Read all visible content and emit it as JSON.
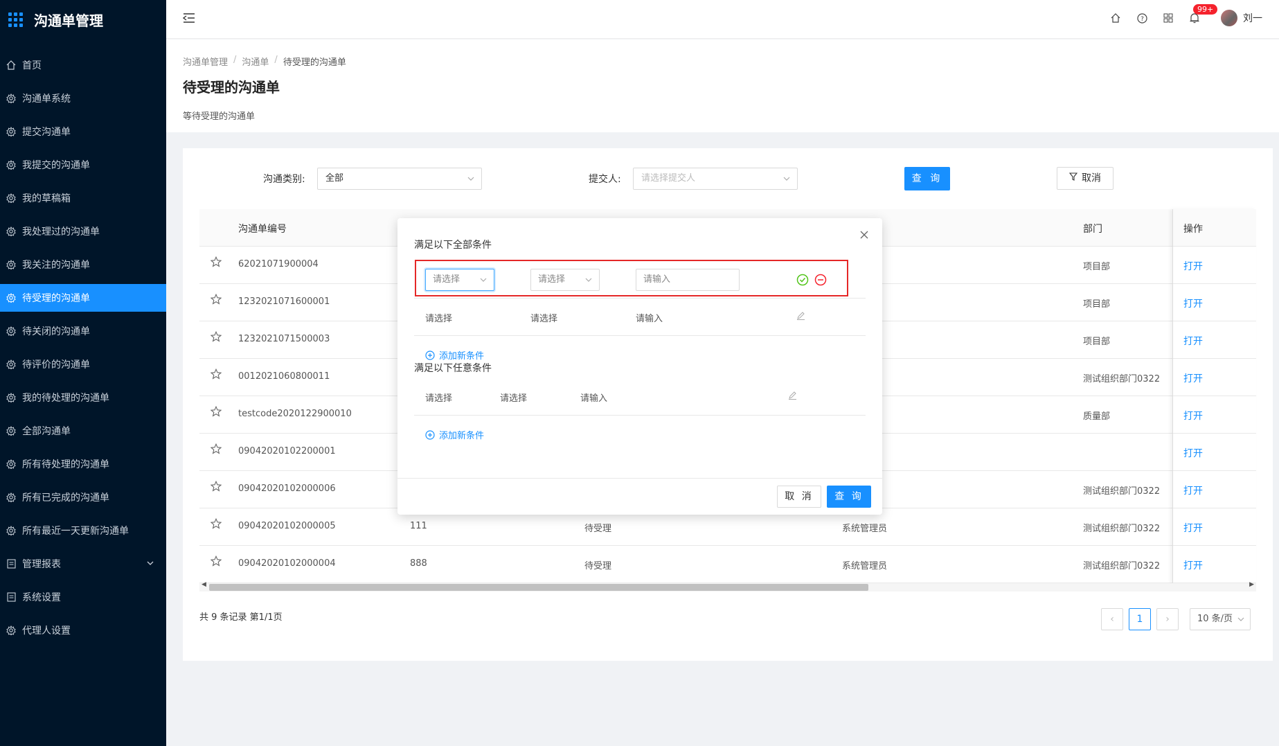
{
  "app": {
    "title": "沟通单管理"
  },
  "sidebar": {
    "items": [
      {
        "label": "首页",
        "icon": "home-icon"
      },
      {
        "label": "沟通单系统",
        "icon": "gear-icon"
      },
      {
        "label": "提交沟通单",
        "icon": "gear-icon"
      },
      {
        "label": "我提交的沟通单",
        "icon": "gear-icon"
      },
      {
        "label": "我的草稿箱",
        "icon": "gear-icon"
      },
      {
        "label": "我处理过的沟通单",
        "icon": "gear-icon"
      },
      {
        "label": "我关注的沟通单",
        "icon": "gear-icon"
      },
      {
        "label": "待受理的沟通单",
        "icon": "gear-icon",
        "active": true
      },
      {
        "label": "待关闭的沟通单",
        "icon": "gear-icon"
      },
      {
        "label": "待评价的沟通单",
        "icon": "gear-icon"
      },
      {
        "label": "我的待处理的沟通单",
        "icon": "gear-icon"
      },
      {
        "label": "全部沟通单",
        "icon": "gear-icon"
      },
      {
        "label": "所有待处理的沟通单",
        "icon": "gear-icon"
      },
      {
        "label": "所有已完成的沟通单",
        "icon": "gear-icon"
      },
      {
        "label": "所有最近一天更新沟通单",
        "icon": "gear-icon"
      },
      {
        "label": "管理报表",
        "icon": "report-icon",
        "has_submenu": true
      },
      {
        "label": "系统设置",
        "icon": "report-icon"
      },
      {
        "label": "代理人设置",
        "icon": "gear-icon"
      }
    ]
  },
  "header": {
    "notification_badge": "99+",
    "user_name": "刘一"
  },
  "breadcrumb": [
    "沟通单管理",
    "沟通单",
    "待受理的沟通单"
  ],
  "page": {
    "title": "待受理的沟通单",
    "description": "等待受理的沟通单"
  },
  "filters": {
    "type_label": "沟通类别:",
    "type_value": "全部",
    "submitter_label": "提交人:",
    "submitter_placeholder": "请选择提交人",
    "query_button": "查 询",
    "cancel_button": "取消"
  },
  "table": {
    "columns": {
      "code": "沟通单编号",
      "dept": "部门",
      "action": "操作"
    },
    "rows": [
      {
        "code": "62021071900004",
        "col2": "",
        "status": "",
        "owner": "",
        "dept": "项目部"
      },
      {
        "code": "1232021071600001",
        "col2": "",
        "status": "",
        "owner": "",
        "dept": "项目部"
      },
      {
        "code": "1232021071500003",
        "col2": "",
        "status": "",
        "owner": "",
        "dept": "项目部"
      },
      {
        "code": "0012021060800011",
        "col2": "",
        "status": "",
        "owner": "",
        "dept": "测试组织部门0322"
      },
      {
        "code": "testcode2020122900010",
        "col2": "",
        "status": "",
        "owner": "",
        "dept": "质量部"
      },
      {
        "code": "09042020102200001",
        "col2": "",
        "status": "",
        "owner": "",
        "dept": ""
      },
      {
        "code": "09042020102000006",
        "col2": "",
        "status": "",
        "owner": "",
        "dept": "测试组织部门0322"
      },
      {
        "code": "09042020102000005",
        "col2": "111",
        "status": "待受理",
        "owner": "系统管理员",
        "dept": "测试组织部门0322"
      },
      {
        "code": "09042020102000004",
        "col2": "888",
        "status": "待受理",
        "owner": "系统管理员",
        "dept": "测试组织部门0322"
      }
    ],
    "action_label": "打开"
  },
  "pagination": {
    "summary": "共 9 条记录 第1/1页",
    "current": "1",
    "page_size": "10 条/页"
  },
  "modal": {
    "all_conditions_title": "满足以下全部条件",
    "any_conditions_title": "满足以下任意条件",
    "select_placeholder": "请选择",
    "input_placeholder": "请输入",
    "add_condition": "添加新条件",
    "cancel_button": "取 消",
    "query_button": "查 询"
  },
  "colors": {
    "accent": "#1890ff",
    "sidebar_bg": "#001529",
    "highlight_border": "#e52727",
    "confirm": "#52c41a",
    "remove": "#f5222d"
  }
}
